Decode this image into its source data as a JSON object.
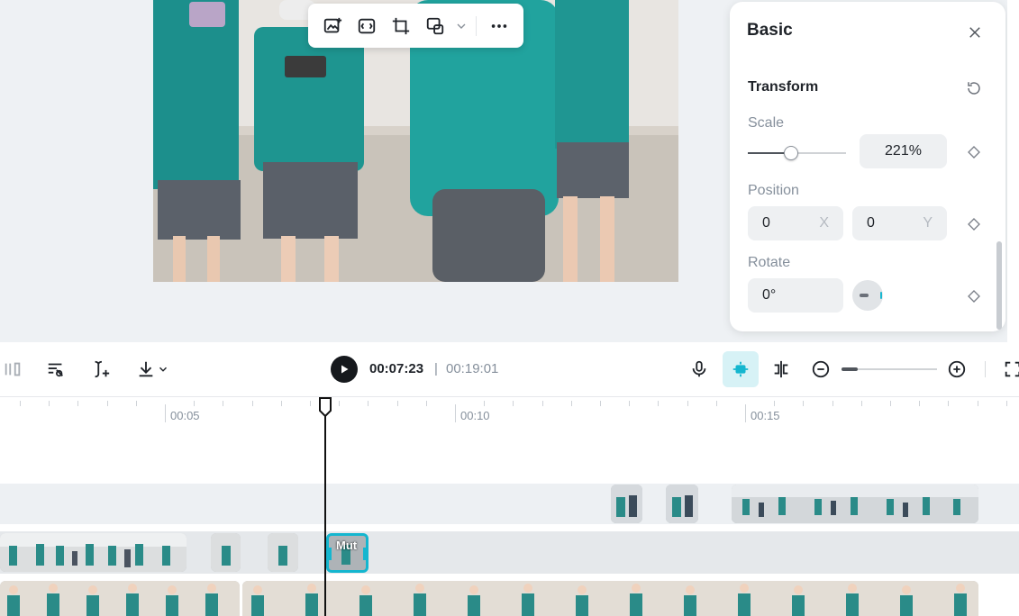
{
  "colors": {
    "accent": "#14b6cf",
    "text": "#1f2329",
    "muted": "#86909c"
  },
  "floating_toolbar": {
    "icons": [
      "add-image-icon",
      "fit-frame-icon",
      "crop-icon",
      "replace-media-icon",
      "more-icon"
    ]
  },
  "panel": {
    "title": "Basic",
    "section": "Transform",
    "scale": {
      "label": "Scale",
      "value": "221%",
      "slider_fraction": 0.44
    },
    "position": {
      "label": "Position",
      "x_value": "0",
      "x_suffix": "X",
      "y_value": "0",
      "y_suffix": "Y"
    },
    "rotate": {
      "label": "Rotate",
      "value": "0°"
    }
  },
  "toolbar": {
    "current_time": "00:07:23",
    "separator": "|",
    "total_time": "00:19:01",
    "zoom_fraction": 0.17
  },
  "ruler": {
    "labels": [
      "00:05",
      "00:10",
      "00:15"
    ]
  },
  "selected_clip": {
    "label": "Mut"
  }
}
